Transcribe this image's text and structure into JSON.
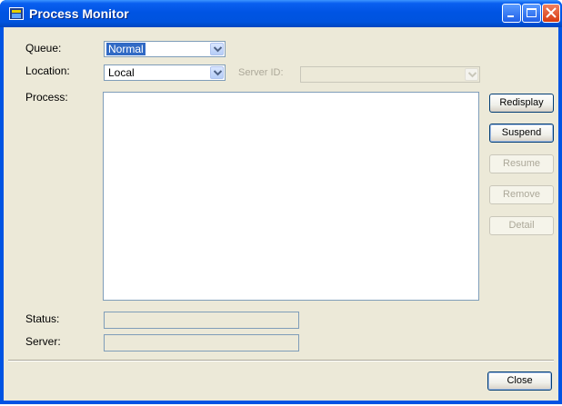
{
  "window": {
    "title": "Process Monitor",
    "title_icon": "app-window-icon"
  },
  "titlebar_buttons": [
    "minimize-icon",
    "maximize-icon",
    "close-icon"
  ],
  "queue": {
    "label": "Queue:",
    "value": "Normal"
  },
  "location": {
    "label": "Location:",
    "value": "Local"
  },
  "server_id": {
    "label": "Server ID:",
    "value": ""
  },
  "process": {
    "label": "Process:",
    "items": []
  },
  "status": {
    "label": "Status:",
    "value": ""
  },
  "server": {
    "label": "Server:",
    "value": ""
  },
  "buttons": {
    "redisplay": "Redisplay",
    "suspend": "Suspend",
    "resume": "Resume",
    "remove": "Remove",
    "detail": "Detail",
    "close": "Close"
  },
  "colors": {
    "titlebar": "#0054e3",
    "face": "#ece9d8",
    "selection": "#316ac5",
    "disabled_text": "#aca899"
  }
}
